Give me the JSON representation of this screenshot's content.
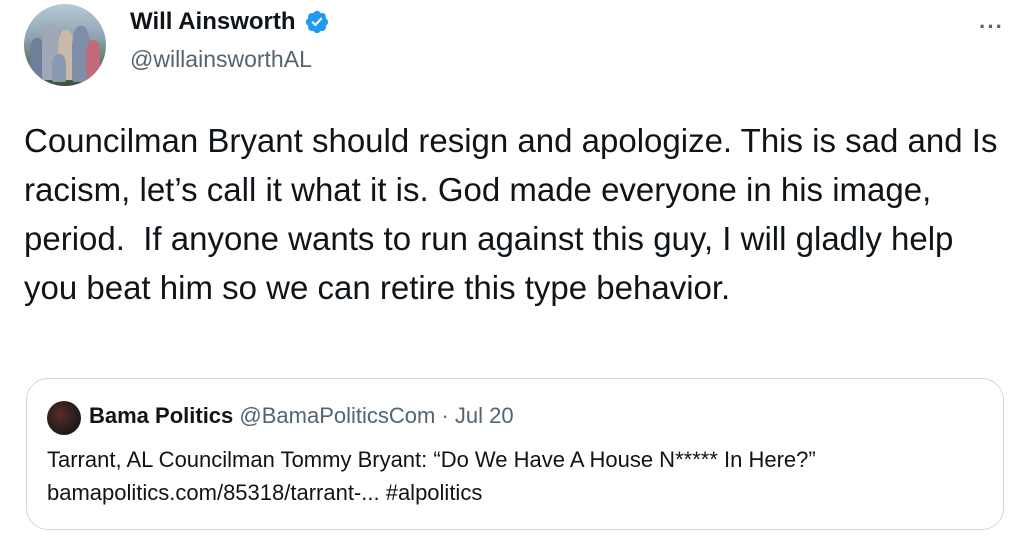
{
  "author": {
    "name": "Will Ainsworth",
    "handle": "@willainsworthAL",
    "verified_icon": "verified-badge-icon",
    "more_icon": "more-options-icon",
    "more_label": "···"
  },
  "tweet": {
    "text": "Councilman Bryant should resign and apologize. This is sad and Is racism, let’s call it what it is. God made everyone in his image, period.  If anyone wants to run against this guy, I will gladly help you beat him so we can retire this type behavior."
  },
  "quoted_tweet": {
    "name": "Bama Politics",
    "handle": "@BamaPoliticsCom",
    "separator": "·",
    "date": "Jul 20",
    "text": "Tarrant, AL Councilman Tommy Bryant: “Do We Have A House N***** In Here?” bamapolitics.com/85318/tarrant-... #alpolitics"
  },
  "colors": {
    "text_primary": "#0f1419",
    "text_secondary": "#536471",
    "verified_blue": "#1d9bf0",
    "border": "#cfd9de"
  }
}
